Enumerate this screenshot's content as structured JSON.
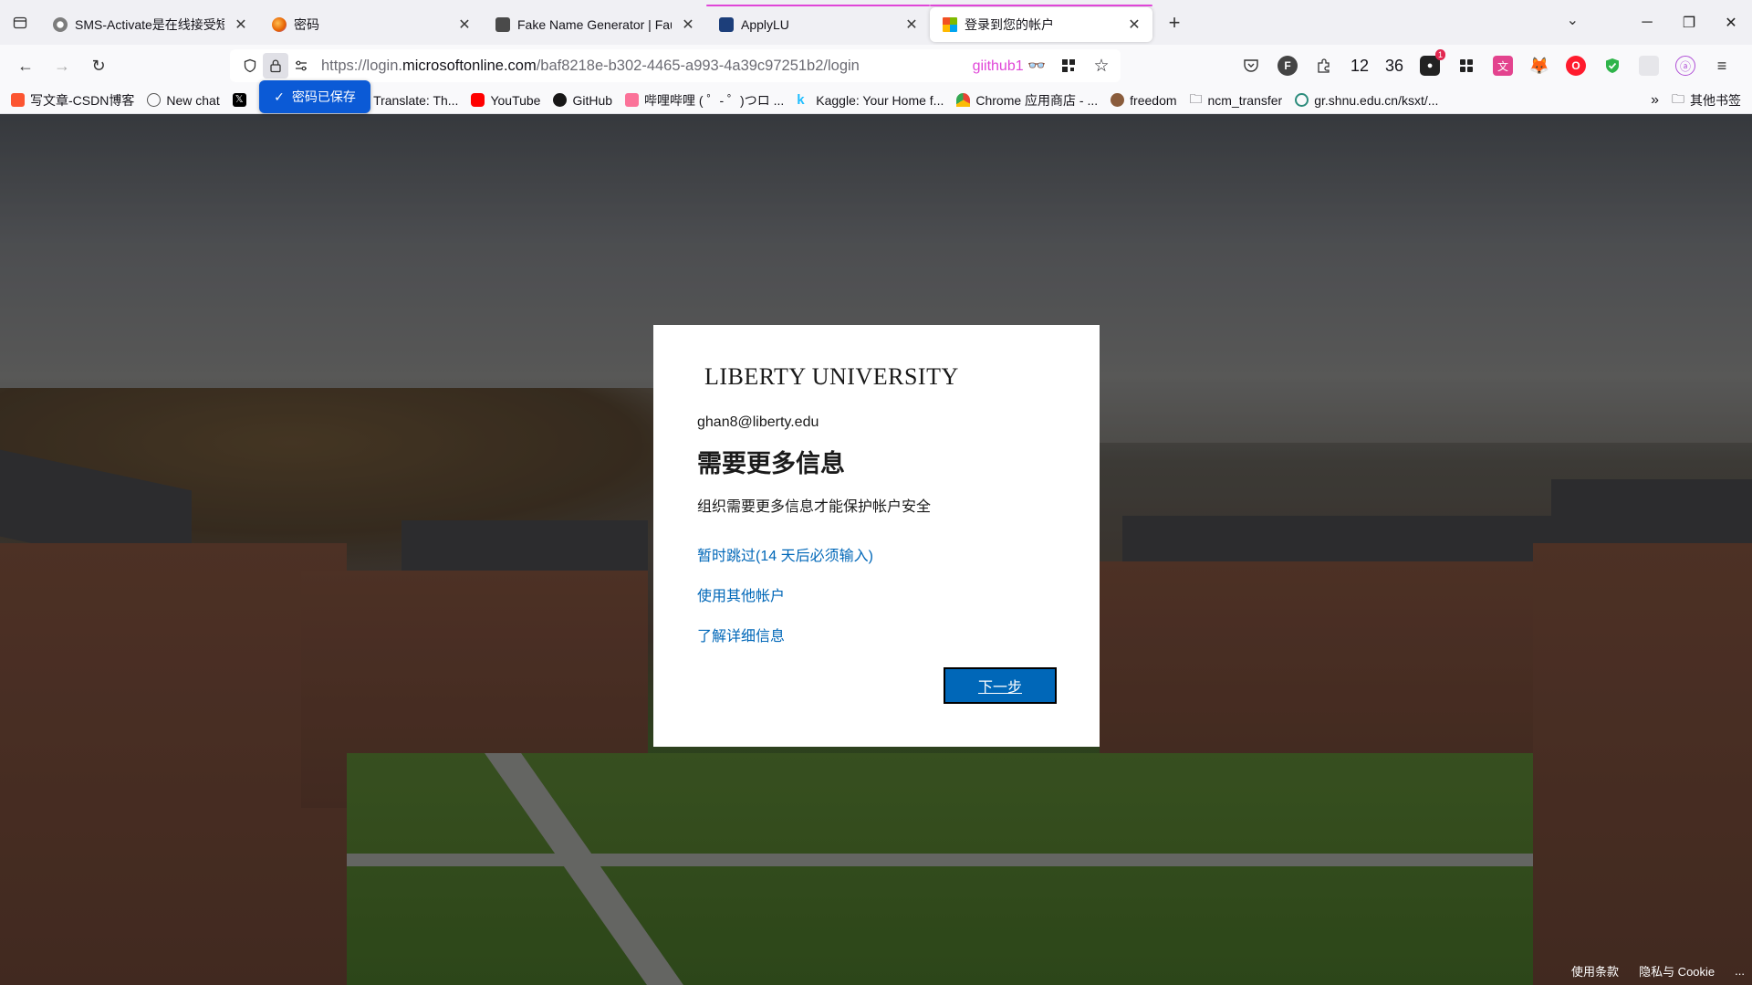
{
  "browser": {
    "tabs": [
      {
        "title": "SMS-Activate是在线接受短信的",
        "active": false,
        "favicon_color": "#7d7d7d"
      },
      {
        "title": "密码",
        "active": false,
        "favicon_color": "#e66000"
      },
      {
        "title": "Fake Name Generator | FauxID",
        "active": false,
        "favicon_color": "#4a4a4a"
      },
      {
        "title": "ApplyLU",
        "active": false,
        "favicon_color": "#1c3e7a"
      },
      {
        "title": "登录到您的帐户",
        "active": true,
        "favicon_color": "#f25022"
      }
    ],
    "url": {
      "prefix": "https://login.",
      "host": "microsoftonline.com",
      "path": "/baf8218e-b302-4465-a993-4a39c97251b2/login"
    },
    "url_extension_label": "giithub1",
    "toolbar_counts": [
      "12",
      "36"
    ],
    "extension_badge": "1",
    "password_saved_popup": "密码已保存",
    "bookmarks": [
      {
        "label": "写文章-CSDN博客",
        "color": "#fc5531"
      },
      {
        "label": "New chat",
        "color": "#555555"
      },
      {
        "label": "X",
        "color": "#000000"
      },
      {
        "label": "DeepL Translate: Th...",
        "color": "#0f2b46"
      },
      {
        "label": "YouTube",
        "color": "#ff0000"
      },
      {
        "label": "GitHub",
        "color": "#181717"
      },
      {
        "label": "哔哩哔哩 ( ゜- ゜)つロ ...",
        "color": "#fb7299"
      },
      {
        "label": "Kaggle: Your Home f...",
        "color": "#20beff"
      },
      {
        "label": "Chrome 应用商店 - ...",
        "color": "#34a853"
      },
      {
        "label": "freedom",
        "color": "#8a5c3c"
      },
      {
        "label": "ncm_transfer",
        "color": "#333333"
      },
      {
        "label": "gr.shnu.edu.cn/ksxt/...",
        "color": "#2c8c7c"
      }
    ],
    "bookmarks_other": "其他书签"
  },
  "signin": {
    "org_name": "LIBERTY UNIVERSITY",
    "identity": "ghan8@liberty.edu",
    "heading": "需要更多信息",
    "description": "组织需要更多信息才能保护帐户安全",
    "links": {
      "skip": "暂时跳过(14 天后必须输入)",
      "other_account": "使用其他帐户",
      "learn_more": "了解详细信息"
    },
    "next_button": "下一步"
  },
  "footer": {
    "terms": "使用条款",
    "privacy": "隐私与 Cookie",
    "more": "..."
  },
  "colors": {
    "accent": "#0067b8",
    "tab_highlight": "#e046d8",
    "saved_popup": "#0b5ad6"
  }
}
